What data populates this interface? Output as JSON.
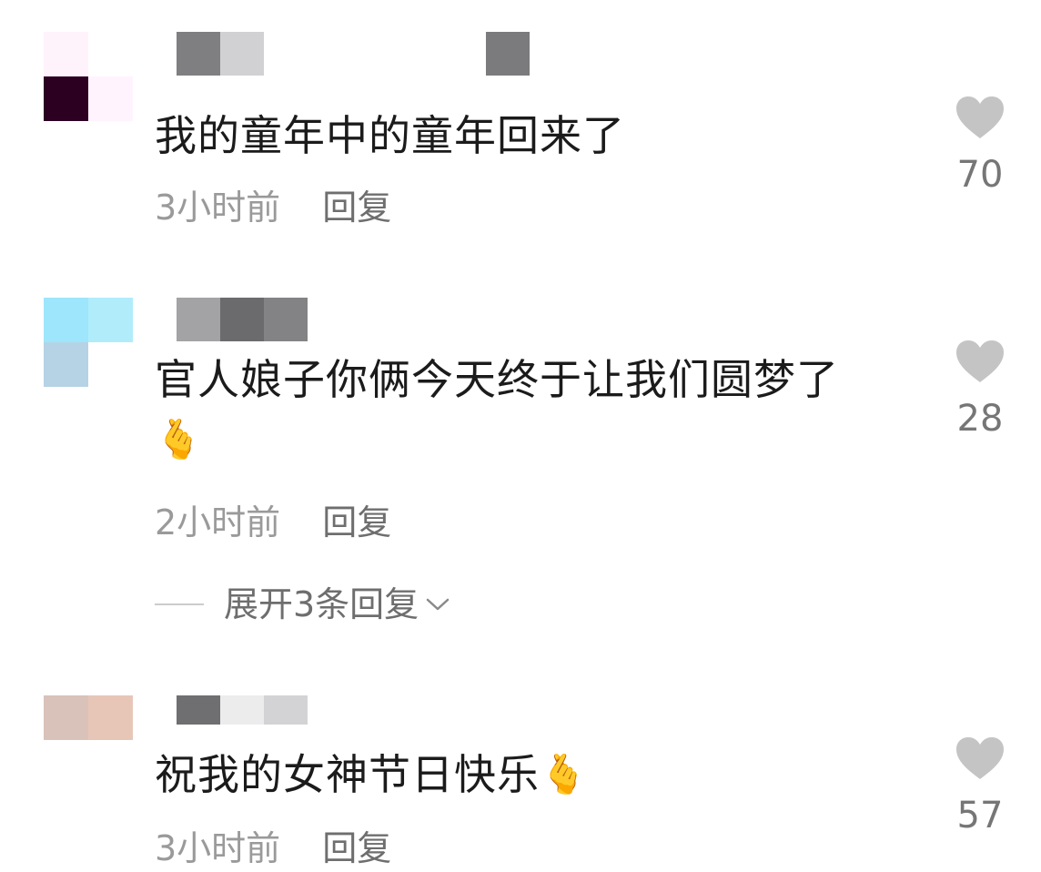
{
  "comments": [
    {
      "text": "我的童年中的童年回来了",
      "emoji": "",
      "time": "3小时前",
      "reply": "回复",
      "likes": "70",
      "avatar_colors": [
        "#fff3fb",
        "#ffffff",
        "#2b0021",
        "#fff4fd"
      ],
      "username_colors": [
        "#7f7e80",
        "#d1d1d3",
        "#ffffff",
        "#ffffff",
        "#ffffff",
        "#ffffff",
        "#ffffff",
        "#ffffff",
        "#7b7b7d"
      ]
    },
    {
      "text": "官人娘子你俩今天终于让我们圆梦了",
      "emoji": "🫰",
      "time": "2小时前",
      "reply": "回复",
      "likes": "28",
      "expand": "展开3条回复",
      "avatar_colors": [
        "#9de6fb",
        "#b1ecfb",
        "#b6d3e5",
        "#ffffff"
      ],
      "username_colors": [
        "#ffffff",
        "#a3a3a5",
        "#6b6b6d",
        "#838385"
      ]
    },
    {
      "text": "祝我的女神节日快乐",
      "emoji": "🫰",
      "time": "3小时前",
      "reply": "回复",
      "likes": "57",
      "avatar_colors": [
        "#d9c2b9",
        "#e7c6b8",
        "#ffffff",
        "#ffffff"
      ],
      "username_colors": [
        "#6f6f71",
        "#ececed",
        "#d3d3d5"
      ]
    }
  ],
  "icons": {
    "like": "heart-icon",
    "expand": "chevron-down-icon"
  },
  "colors": {
    "heart": "#c4c4c4"
  }
}
